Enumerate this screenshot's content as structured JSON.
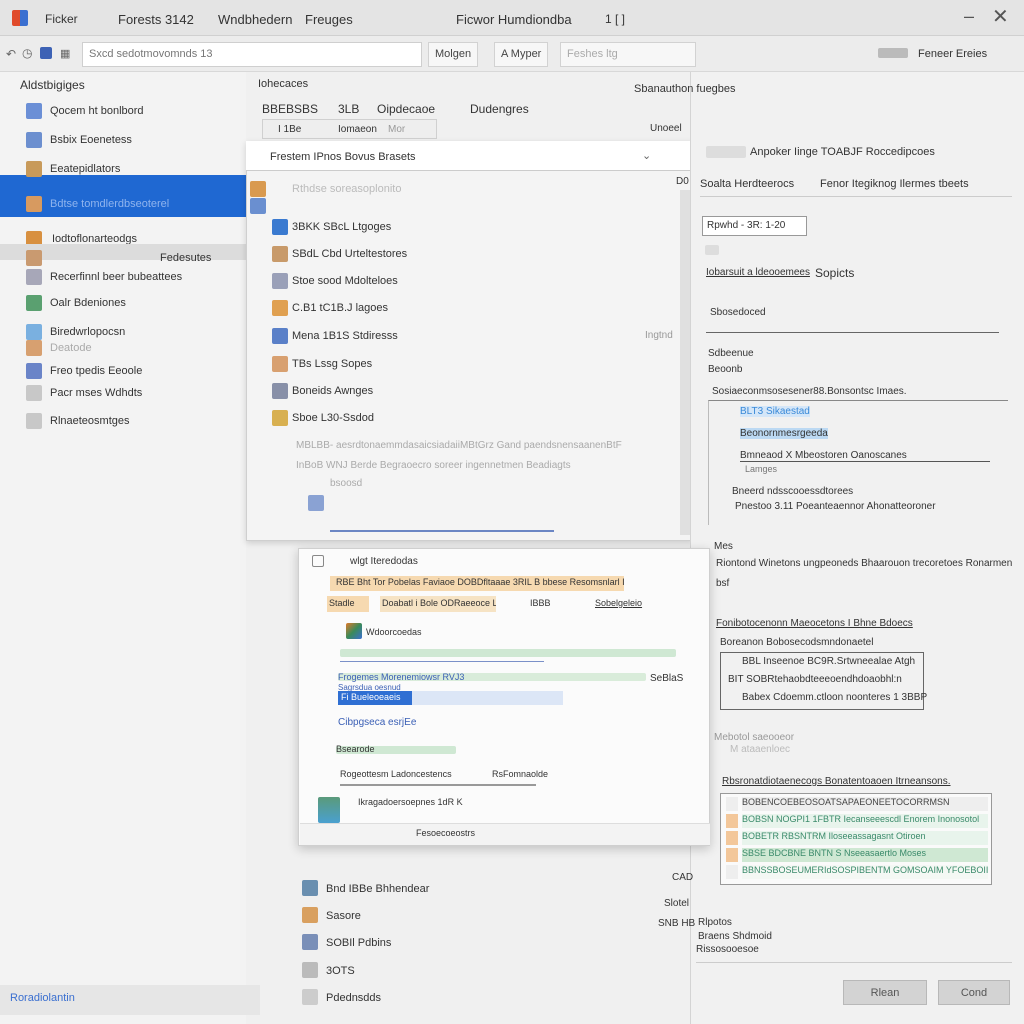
{
  "titlebar": {
    "app": "Ficker",
    "menus": [
      "Forests 3142",
      "Wndbhedern",
      "Freuges"
    ],
    "title": "Ficwor Humdiondba",
    "extra": "1 [ ]"
  },
  "toolbar": {
    "search_value": "Sxcd sedotmovomnds 13",
    "buttons": [
      "Molgen",
      "A Myper",
      "Feshes ltg"
    ],
    "right_label": "Feneer Ereies"
  },
  "sidebar": {
    "header": "Aldstbigiges",
    "items": [
      "Qocem ht bonlbord",
      "Bsbix Eoenetess",
      "Eeatepidlators",
      "Bdtse tomdlerdbseoterel",
      "Iodtoflonarteodgs",
      "Fedesutes",
      "Recerfinnl beer bubeattees",
      "Oalr Bdeniones",
      "Biredwrlopocsn",
      "Deatode",
      "Freo tpedis Eeoole",
      "Pacr mses Wdhdts",
      "Rlnaeteosmtges"
    ],
    "status": "Roradiolantin"
  },
  "main": {
    "header": "Iohecaces",
    "tabs": [
      "BBEBSBS",
      "3LB",
      "Oipdecaoe",
      "Dudengres"
    ],
    "subtabs": [
      "I 1Be",
      "Iomaeon",
      "Mor"
    ]
  },
  "dropdown": {
    "title": "Frestem IPnos Bovus Brasets",
    "items": [
      "Rthdse soreasoplonito",
      "",
      "3BKK SBcL Ltgoges",
      "SBdL Cbd Urteltestores",
      "Stoe sood Mdolteloes",
      "C.B1 tC1B.J lagoes",
      "Mena 1B1S Stdiresss",
      "TBs Lssg Sopes",
      "Boneids Awnges",
      "Sboe L30-Ssdod"
    ],
    "side_notes": [
      "Ingtnd",
      "D0"
    ],
    "faint": [
      "MBLBB- aesrdtonaemmdasaicsiadaiiMBtGrz Gand paendsnensaanenBtF",
      "InBoB WNJ Berde Begraoecro soreer ingennetmen Beadiagts",
      "bsoosd"
    ]
  },
  "dialog": {
    "title": "wlgt Iteredodas",
    "row1": "RBE Bht Tor Pobelas Faviaoe DOBDfltaaae 3RIL B bbese Resomsnlarl IBB",
    "row2_tags": [
      "Stadle",
      "Doabatl i Bole ODRaeeoce LBI",
      "IBBB",
      "Sobelgeleio"
    ],
    "item": "Wdoorcoedas",
    "field1": "Frogemes Morenemiowsr RVJ3",
    "field1b": "Sagrsdua oesnud",
    "field1_right": "SeBlaS",
    "selected": "Fi Bueleoeaeis",
    "label2": "Cibpgseca esrjEe",
    "field3": "Bsearode",
    "row4a": "Rogeottesm Ladoncestencs",
    "row4b": "RsFomnaolde",
    "row5": "Ikragadoersoepnes 1dR K",
    "footer": "Fesoecoeostrs"
  },
  "lower_list": [
    "Bnd IBBe Bhhendear",
    "Sasore",
    "SOBIl Pdbins",
    "3OTS",
    "Pdednsdds"
  ],
  "lower_side": [
    "CAD",
    "Slotel",
    "SNB HB"
  ],
  "right": {
    "header": "Sbanauthon fuegbes",
    "sub": "Unoeel",
    "line1": "Anpoker Iinge TOABJF Roccedipcoes",
    "line2a": "Soalta Herdteerocs",
    "line2b": "Fenor Itegiknog Ilermes tbeets",
    "input": "Rpwhd - 3R: 1-20",
    "link": "Iobarsuit a ldeooemees",
    "link2": "Sopicts",
    "field": "Sbosedoced",
    "label1": "Sdbeenue",
    "label2": "Beoonb",
    "tree_title": "Sosiaeconmsosesener88.Bonsontsc Imaes.",
    "tree": [
      "BLT3 Sikaestad",
      "Beonornmesrgeeda",
      "Bmneaod X Mbeostoren Oanoscanes",
      "Lamges"
    ],
    "note1": "Bneerd ndsscooessdtorees",
    "note2": "Pnestoo 3.11 Poeanteaennor Ahonatteoroner",
    "mes": "Mes",
    "desc": "Riontond Winetons ungpeoneds Bhaarouon trecoretoes Ronarmen",
    "desc2": "bsf",
    "group_title": "Fonibotocenonn Maeocetons I Bhne Bdoecs",
    "group_rows": [
      "Boreanon Bobosecodsmndonaetel",
      "BBL Inseenoe BC9R.Srtwneealae Atgh",
      "BIT SOBRtehaobdteeeoendhdoaobhl:n",
      "Babex Cdoemm.ctloon noonteres 1 3BBP"
    ],
    "faint1": "Mebotol saeooeor",
    "faint2": "M ataaenloec",
    "list_title": "Rbsronatdiotaenecogs Bonatentoaoen Itrneansons.",
    "list": [
      "BOBENCOEBEOSOATSAPAEONEETOCORRMSN",
      "BOBSN NOGPI1 1FBTR Iecanseeescdl Enorem Inonosotol",
      "BOBETR RBSNTRM Iloseeassagasnt Otiroen",
      "SBSE BDCBNE BNTN S Nseeasaertlo Moses",
      "BBNSSBOSEUMERIdSOSPIBENTM GOMSOAIM YFOEBOIIISBSdsnt BBBE"
    ],
    "foot1": "Rlpotos",
    "foot2": "Braens Shdmoid",
    "foot3": "Rissosooesoe",
    "buttons": [
      "Rlean",
      "Cond"
    ]
  },
  "colors": {
    "accent": "#1f68d2",
    "highlight_orange": "#f6d9b0",
    "highlight_green": "#cfe8d3"
  }
}
